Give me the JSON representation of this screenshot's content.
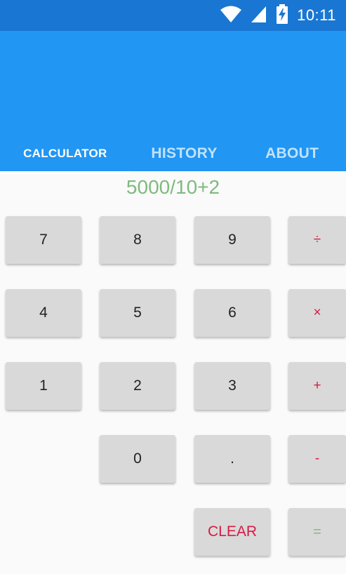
{
  "status_bar": {
    "time": "10:11",
    "icons": [
      "wifi-icon",
      "cell-signal-icon",
      "battery-charging-icon"
    ]
  },
  "colors": {
    "status_bar": "#1976d2",
    "app_bar": "#2196f3",
    "display_text": "#7fba7f",
    "operator_text": "#d81b45",
    "key_background": "#d9d9d9"
  },
  "tabs": [
    {
      "label": "CALCULATOR",
      "active": true
    },
    {
      "label": "HISTORY",
      "active": false
    },
    {
      "label": "ABOUT",
      "active": false
    }
  ],
  "display": {
    "expression": "5000/10+2"
  },
  "keys": {
    "seven": "7",
    "eight": "8",
    "nine": "9",
    "divide": "÷",
    "four": "4",
    "five": "5",
    "six": "6",
    "multiply": "×",
    "one": "1",
    "two": "2",
    "three": "3",
    "plus": "+",
    "zero": "0",
    "dot": ".",
    "minus": "-",
    "clear": "CLEAR",
    "equals": "="
  }
}
